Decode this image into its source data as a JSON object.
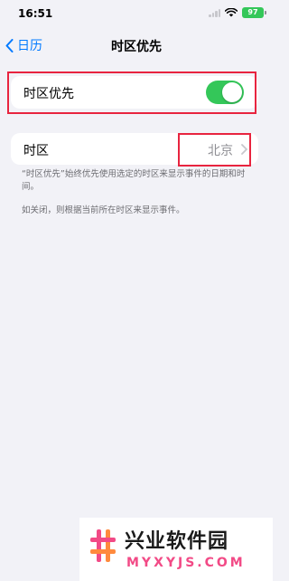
{
  "status_bar": {
    "time": "16:51",
    "battery": "97"
  },
  "nav": {
    "back_label": "日历",
    "title": "时区优先"
  },
  "toggle_row": {
    "label": "时区优先",
    "enabled": true
  },
  "timezone_row": {
    "label": "时区",
    "value": "北京"
  },
  "footnotes": [
    "“时区优先”始终优先使用选定的时区来显示事件的日期和时间。",
    "如关闭，则根据当前所在时区来显示事件。"
  ],
  "highlight_color": "#e8243f",
  "accent_color": "#007aff",
  "switch_color": "#34c759",
  "watermark": {
    "title": "兴业软件园",
    "domain": "MYXYJS.COM"
  }
}
